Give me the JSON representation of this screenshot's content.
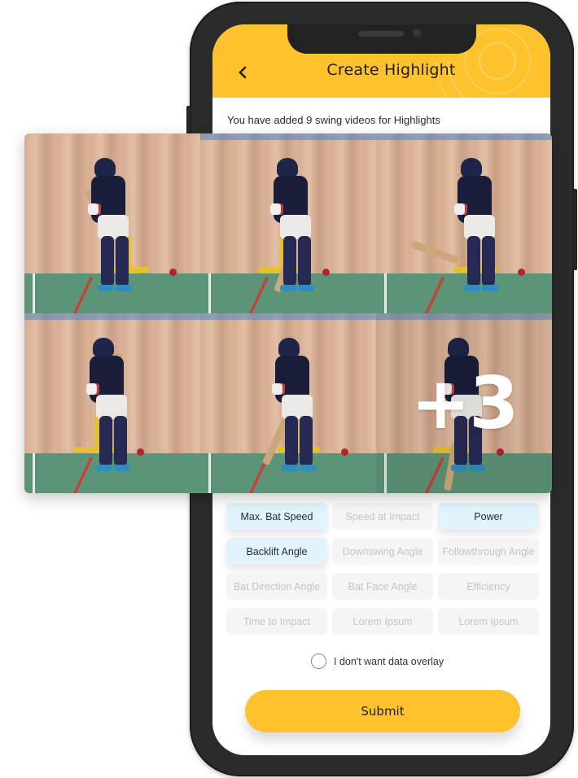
{
  "header": {
    "title": "Create Highlight",
    "back_icon": "chevron-left-icon",
    "color": "#fdc22c"
  },
  "subtitle": "You have added 9 swing videos for Highlights",
  "videos": {
    "total": 9,
    "shown": 6,
    "more_label": "+3",
    "tiles": [
      {
        "pose": "stance-bat-raised"
      },
      {
        "pose": "stance-crouched"
      },
      {
        "pose": "backlift"
      },
      {
        "pose": "bat-high"
      },
      {
        "pose": "downswing"
      },
      {
        "pose": "stance",
        "overlay": "+3"
      }
    ]
  },
  "metrics": [
    {
      "label": "Max. Bat Speed",
      "selected": true
    },
    {
      "label": "Speed at Impact",
      "selected": false
    },
    {
      "label": "Power",
      "selected": true
    },
    {
      "label": "Backlift Angle",
      "selected": true
    },
    {
      "label": "Downswing Angle",
      "selected": false
    },
    {
      "label": "Followthrough Angle",
      "selected": false
    },
    {
      "label": "Bat Direction Angle",
      "selected": false
    },
    {
      "label": "Bat Face Angle",
      "selected": false
    },
    {
      "label": "Efficiency",
      "selected": false
    },
    {
      "label": "Time to Impact",
      "selected": false
    },
    {
      "label": "Lorem Ipsum",
      "selected": false
    },
    {
      "label": "Lorem Ipsum",
      "selected": false
    }
  ],
  "overlay_option": {
    "label": "I don't want data overlay",
    "checked": false
  },
  "submit_label": "Submit",
  "colors": {
    "accent": "#fdc22c",
    "chip_selected": "#e2f3fc",
    "chip_default": "#f5f5f5"
  }
}
